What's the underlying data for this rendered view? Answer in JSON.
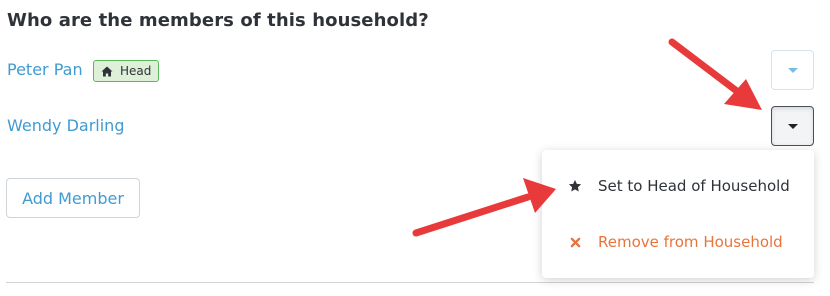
{
  "title": "Who are the members of this household?",
  "members": [
    {
      "name": "Peter Pan",
      "badge": "Head"
    },
    {
      "name": "Wendy Darling"
    }
  ],
  "add_button_label": "Add Member",
  "menu": {
    "items": [
      {
        "label": "Set to Head of Household",
        "icon": "star-icon"
      },
      {
        "label": "Remove from Household",
        "icon": "x-icon"
      }
    ]
  },
  "colors": {
    "link": "#3f9bd1",
    "badge_bg": "#dff0d8",
    "badge_border": "#5cb85c",
    "remove": "#e8743b",
    "annotation_arrow": "#e8393b"
  }
}
